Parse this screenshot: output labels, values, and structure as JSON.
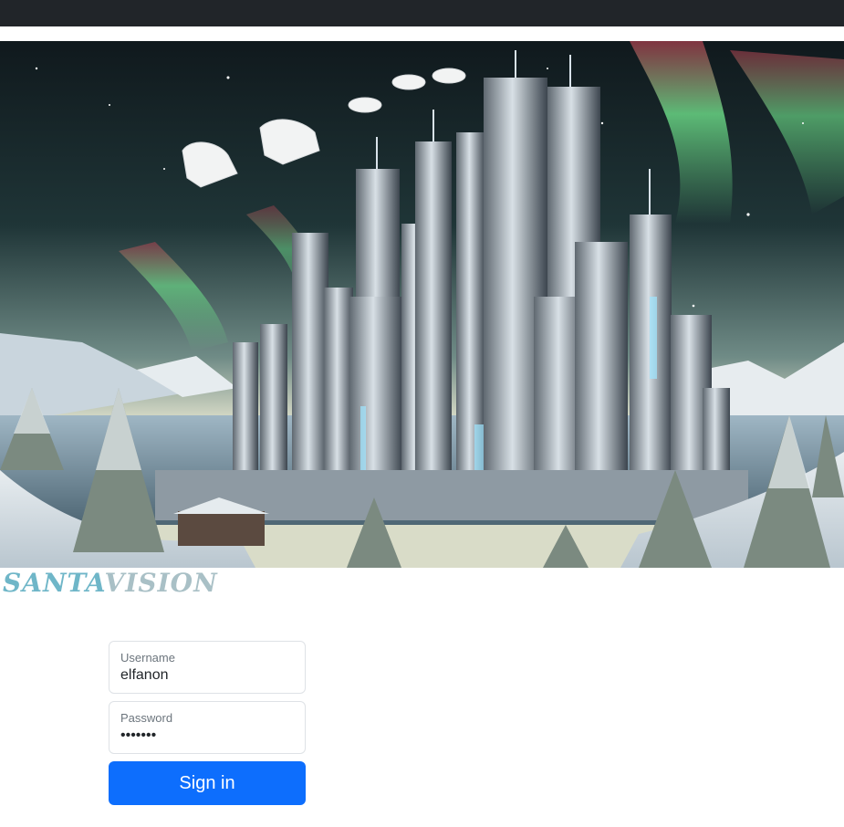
{
  "topbar": {},
  "hero": {
    "image": "arctic-futuristic-city-with-santa-sleigh-reindeer-aurora"
  },
  "logo": {
    "part1": "SANTA",
    "part2": "VISION"
  },
  "login": {
    "username_label": "Username",
    "username_value": "elfanon",
    "password_label": "Password",
    "password_value": "•••••••",
    "signin_label": "Sign in"
  },
  "colors": {
    "topbar": "#212529",
    "accent": "#0d6efd",
    "logo_primary": "#6fb6c8",
    "logo_secondary": "#a9c0c6"
  }
}
